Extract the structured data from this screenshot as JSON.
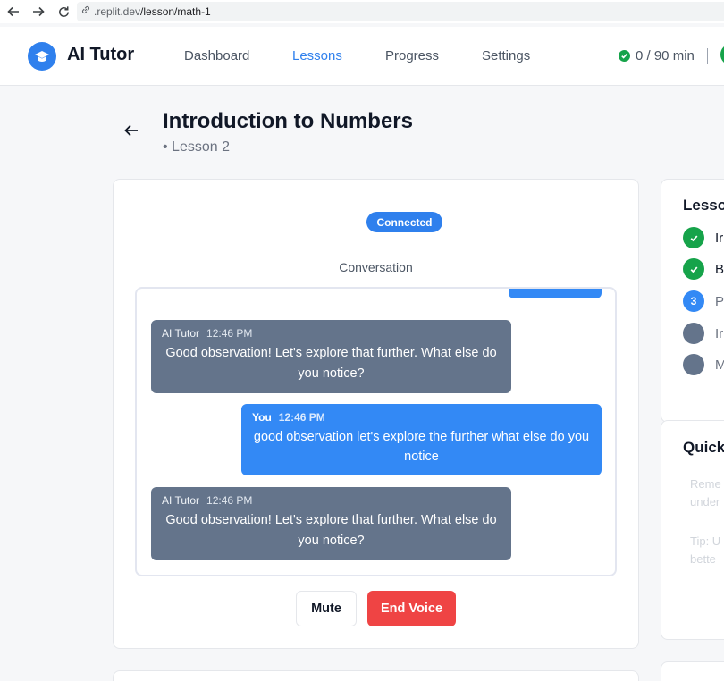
{
  "browser": {
    "url_domain": ".replit.dev",
    "url_path": "/lesson/math-1"
  },
  "header": {
    "brand": "AI Tutor",
    "nav": [
      {
        "label": "Dashboard",
        "active": false
      },
      {
        "label": "Lessons",
        "active": true
      },
      {
        "label": "Progress",
        "active": false
      },
      {
        "label": "Settings",
        "active": false
      }
    ],
    "usage": "0 / 90 min"
  },
  "lesson": {
    "title": "Introduction to Numbers",
    "subtitle": "• Lesson 2"
  },
  "voice": {
    "status": "Connected",
    "conversation_label": "Conversation",
    "messages": [
      {
        "sender": "AI Tutor",
        "time": "12:46 PM",
        "text": "Good observation! Let's explore that further. What else do you notice?"
      },
      {
        "sender": "You",
        "time": "12:46 PM",
        "text": "good observation let's explore the further what else do you notice"
      },
      {
        "sender": "AI Tutor",
        "time": "12:46 PM",
        "text": "Good observation! Let's explore that further. What else do you notice?"
      }
    ],
    "mute_label": "Mute",
    "end_label": "End Voice"
  },
  "sidebar": {
    "progress_title": "Lesso",
    "steps": [
      {
        "marker": "",
        "label": "Ir",
        "state": "done"
      },
      {
        "marker": "",
        "label": "B",
        "state": "done"
      },
      {
        "marker": "3",
        "label": "P",
        "state": "current"
      },
      {
        "marker": "",
        "label": "Ir",
        "state": "pending"
      },
      {
        "marker": "",
        "label": "M",
        "state": "pending"
      }
    ],
    "quick_title": "Quick",
    "quick_lines": [
      "Reme",
      "under",
      "Tip: U",
      "bette"
    ]
  },
  "colors": {
    "accent": "#2f80ed",
    "user_bubble": "#3389f5",
    "ai_bubble": "#64748b",
    "danger": "#ef4444",
    "success": "#16a34a",
    "pending": "#64748b"
  }
}
